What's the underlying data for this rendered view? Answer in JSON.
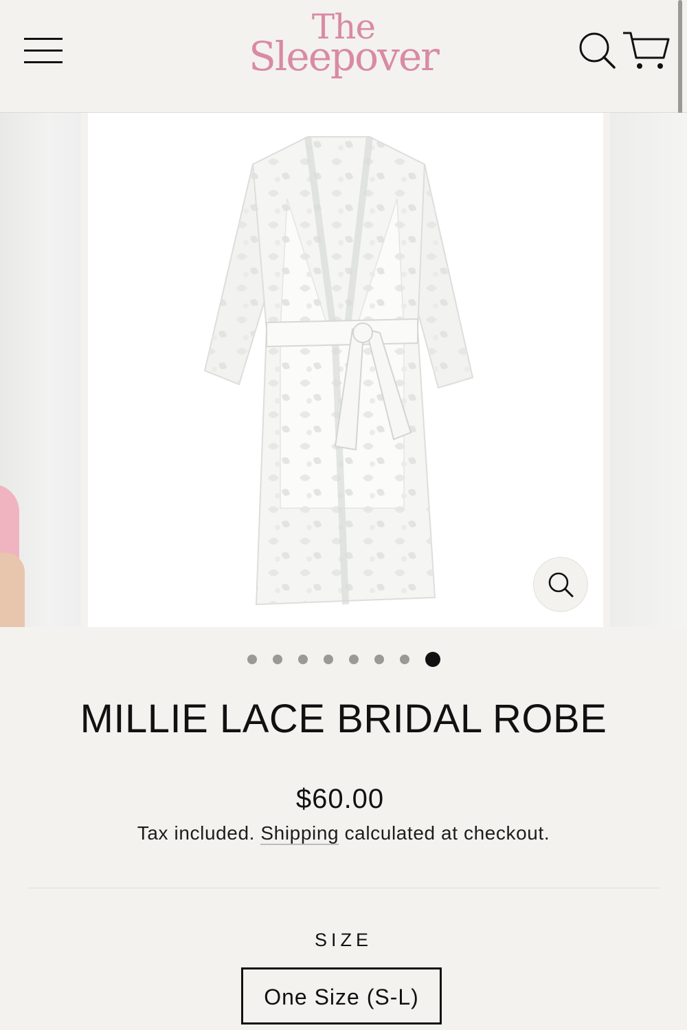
{
  "header": {
    "logo_line1": "The",
    "logo_line2": "Sleepover",
    "menu_icon": "hamburger-icon",
    "search_icon": "search-icon",
    "cart_icon": "cart-icon"
  },
  "gallery": {
    "slide_count": 8,
    "active_slide": 8,
    "zoom_icon": "zoom-icon"
  },
  "product": {
    "title": "MILLIE LACE BRIDAL ROBE",
    "price": "$60.00",
    "tax_prefix": "Tax included.",
    "shipping_link": "Shipping",
    "tax_suffix": "calculated at checkout.",
    "size_label": "SIZE",
    "size_selected": "One Size (S-L)"
  },
  "colors": {
    "background": "#f3f2ee",
    "logo_pink": "#d98aa5",
    "text": "#111111"
  }
}
